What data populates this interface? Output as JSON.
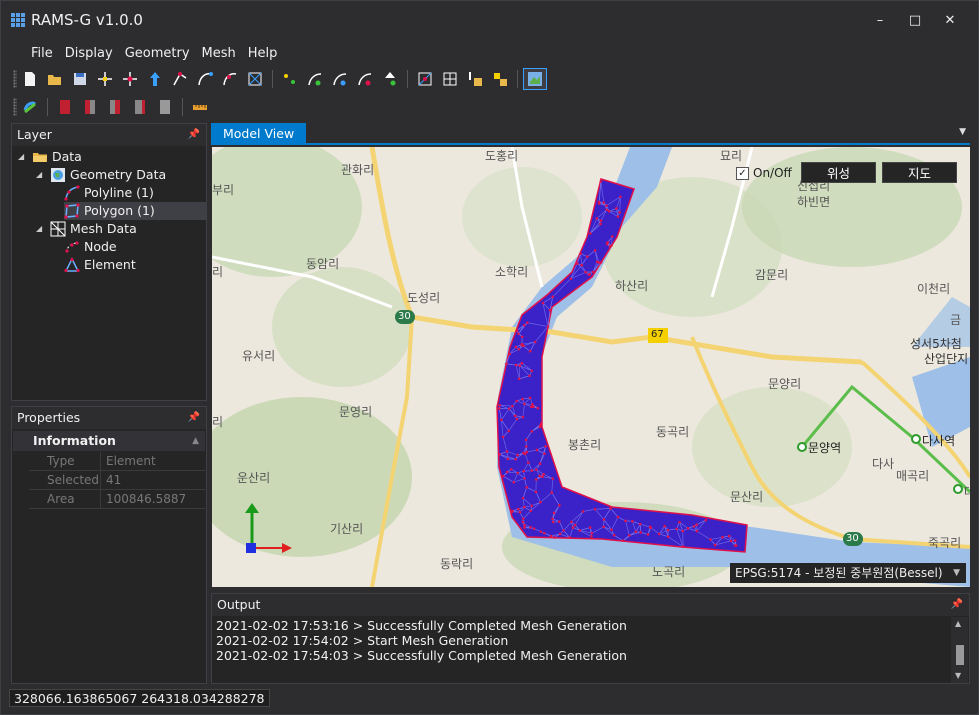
{
  "window": {
    "title": "RAMS-G v1.0.0",
    "minimize": "–",
    "maximize": "□",
    "close": "✕"
  },
  "menu": [
    "File",
    "Display",
    "Geometry",
    "Mesh",
    "Help"
  ],
  "layer_panel": {
    "title": "Layer",
    "tree": [
      {
        "label": "Data",
        "icon": "folder-icon"
      },
      {
        "label": "Geometry Data",
        "icon": "globe-icon"
      },
      {
        "label": "Polyline (1)",
        "icon": "polyline-icon"
      },
      {
        "label": "Polygon (1)",
        "icon": "polygon-icon",
        "selected": true
      },
      {
        "label": "Mesh Data",
        "icon": "mesh-grid-icon"
      },
      {
        "label": "Node",
        "icon": "node-icon"
      },
      {
        "label": "Element",
        "icon": "element-icon"
      }
    ]
  },
  "properties_panel": {
    "title": "Properties",
    "category": "Information",
    "rows": [
      {
        "key": "Type",
        "value": "Element"
      },
      {
        "key": "Selected",
        "value": "41"
      },
      {
        "key": "Area",
        "value": "100846.5887"
      }
    ]
  },
  "model_view": {
    "tab": "Model View",
    "onoff_label": "On/Off",
    "onoff_checked": true,
    "satellite_button": "위성",
    "map_button": "지도",
    "crs": "EPSG:5174 - 보정된 중부원점(Bessel)",
    "map_labels": {
      "dohongri": "도홍리",
      "myori": "묘리",
      "gwanhwari": "관화리",
      "buri": "부리",
      "dongaeri": "동암리",
      "sohakri": "소학리",
      "hasanri": "하산리",
      "sinjeob": "신접리",
      "habinmyeon": "하빈면",
      "gammunri": "감문리",
      "icheonri": "이천리",
      "doseongri": "도성리",
      "yuseori": "유서리",
      "seongseo": "성서5차첨",
      "sanbup": "산업단지",
      "munyangri": "문양리",
      "munyeongri": "문영리",
      "bongchonri": "봉촌리",
      "donggokri": "동곡리",
      "munyangyeok": "문양역",
      "dasayeok": "다사역",
      "dasa": "다사",
      "maegokri": "매곡리",
      "munsanri": "문산리",
      "unsanri": "운산리",
      "gisanri": "기산리",
      "dongnakri": "동락리",
      "nogokri": "노곡리",
      "jukgokri": "죽곡리",
      "ri_left": "리",
      "ri_left2": "리",
      "geum": "금",
      "dae": "대",
      "route30a": "30",
      "route30b": "30",
      "route67": "67"
    }
  },
  "output_panel": {
    "title": "Output",
    "lines": [
      "2021-02-02 17:53:16 > Successfully Completed Mesh Generation",
      "2021-02-02 17:54:02 > Start Mesh Generation",
      "2021-02-02 17:54:03 > Successfully Completed Mesh Generation"
    ]
  },
  "status": {
    "coordinates": "328066.163865067 264318.034288278"
  },
  "colors": {
    "accent": "#007acc",
    "mesh_fill": "#3b22c8",
    "mesh_node": "#e0104a",
    "river": "#7fa7dd"
  }
}
